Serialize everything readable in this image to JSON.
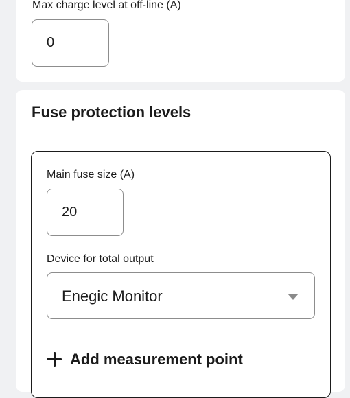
{
  "offline": {
    "max_charge_label": "Max charge level at off-line (A)",
    "max_charge_value": "0"
  },
  "fuse_protection": {
    "title": "Fuse protection levels",
    "main_fuse_label": "Main fuse size (A)",
    "main_fuse_value": "20",
    "device_label": "Device for total output",
    "device_selected": "Enegic Monitor",
    "add_measurement_label": "Add measurement point"
  },
  "icons": {
    "dropdown": "chevron-down-icon",
    "add": "plus-icon"
  },
  "colors": {
    "background": "#f0f1f3",
    "card": "#ffffff",
    "text": "#1b1b1b",
    "input_border": "#8d8d8d",
    "caret": "#8a8a8a"
  }
}
